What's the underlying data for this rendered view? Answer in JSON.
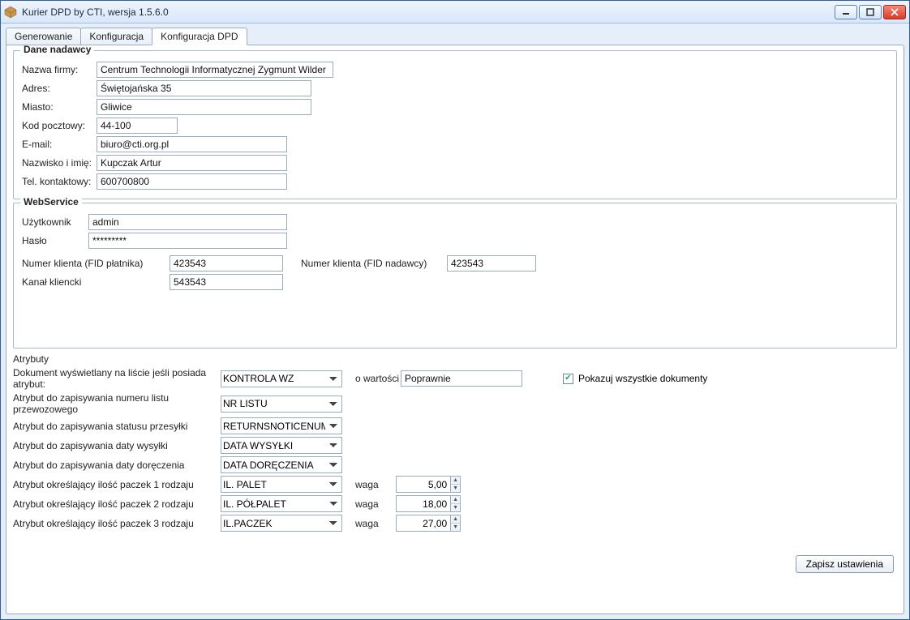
{
  "window": {
    "title": "Kurier DPD by CTI, wersja 1.5.6.0",
    "icon_name": "package-icon"
  },
  "tabs": [
    {
      "label": "Generowanie",
      "active": false
    },
    {
      "label": "Konfiguracja",
      "active": false
    },
    {
      "label": "Konfiguracja DPD",
      "active": true
    }
  ],
  "sender": {
    "legend": "Dane nadawcy",
    "company_label": "Nazwa firmy:",
    "company": "Centrum Technologii Informatycznej Zygmunt Wilder",
    "address_label": "Adres:",
    "address": "Świętojańska 35",
    "city_label": "Miasto:",
    "city": "Gliwice",
    "postal_label": "Kod pocztowy:",
    "postal": "44-100",
    "email_label": "E-mail:",
    "email": "biuro@cti.org.pl",
    "name_label": "Nazwisko i imię:",
    "name": "Kupczak Artur",
    "phone_label": "Tel. kontaktowy:",
    "phone": "600700800"
  },
  "ws": {
    "legend": "WebService",
    "user_label": "Użytkownik",
    "user": "admin",
    "pass_label": "Hasło",
    "pass": "*********",
    "fid_payer_label": "Numer klienta (FID płatnika)",
    "fid_payer": "423543",
    "fid_sender_label": "Numer klienta (FID nadawcy)",
    "fid_sender": "423543",
    "channel_label": "Kanał kliencki",
    "channel": "543543"
  },
  "attrs": {
    "section_label": "Atrybuty",
    "doc_visible_label": "Dokument wyświetlany na liście jeśli posiada atrybut:",
    "doc_visible_value": "KONTROLA WZ",
    "o_wartosci_label": "o wartości",
    "o_wartosci_value": "Poprawnie",
    "show_all_label": "Pokazuj wszystkie dokumenty",
    "show_all_checked": true,
    "waybill_label": "Atrybut do zapisywania numeru listu przewozowego",
    "waybill_value": "NR LISTU",
    "status_label": "Atrybut do zapisywania statusu przesyłki",
    "status_value": "RETURNSNOTICENUMBER",
    "shipdate_label": "Atrybut do zapisywania daty wysyłki",
    "shipdate_value": "DATA WYSYŁKI",
    "delivdate_label": "Atrybut do zapisywania daty doręczenia",
    "delivdate_value": "DATA DORĘCZENIA",
    "waga_label": "waga",
    "pkg1_label": "Atrybut określający ilość paczek 1 rodzaju",
    "pkg1_value": "IL. PALET",
    "pkg1_weight": "5,00",
    "pkg2_label": "Atrybut określający ilość paczek 2 rodzaju",
    "pkg2_value": "IL. PÓŁPALET",
    "pkg2_weight": "18,00",
    "pkg3_label": "Atrybut określający ilość paczek 3 rodzaju",
    "pkg3_value": "IL.PACZEK",
    "pkg3_weight": "27,00"
  },
  "buttons": {
    "save": "Zapisz ustawienia"
  }
}
